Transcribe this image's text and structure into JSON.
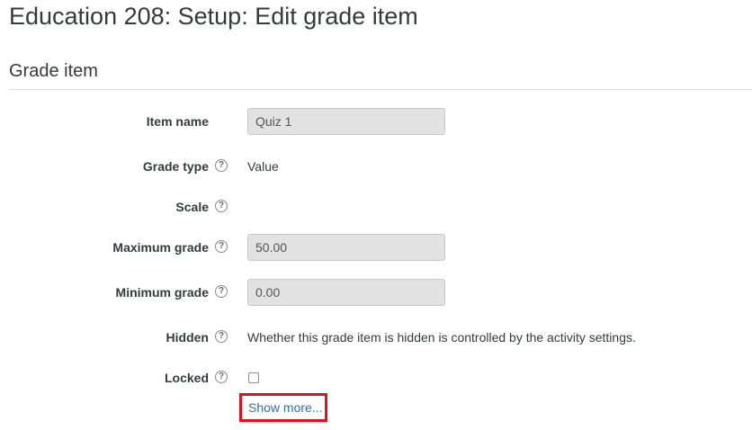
{
  "page": {
    "title": "Education 208: Setup: Edit grade item"
  },
  "section": {
    "title": "Grade item"
  },
  "fields": {
    "item_name": {
      "label": "Item name",
      "value": "Quiz 1"
    },
    "grade_type": {
      "label": "Grade type",
      "value": "Value"
    },
    "scale": {
      "label": "Scale"
    },
    "maximum_grade": {
      "label": "Maximum grade",
      "value": "50.00"
    },
    "minimum_grade": {
      "label": "Minimum grade",
      "value": "0.00"
    },
    "hidden": {
      "label": "Hidden",
      "value": "Whether this grade item is hidden is controlled by the activity settings."
    },
    "locked": {
      "label": "Locked",
      "checked": false
    }
  },
  "help_icon_glyph": "?",
  "show_more": {
    "label": "Show more..."
  },
  "colors": {
    "link": "#2e6eb5",
    "highlight_box": "#e3101f",
    "input_background": "#e2e2e2"
  },
  "icons": {
    "help": "question-circle-icon"
  }
}
